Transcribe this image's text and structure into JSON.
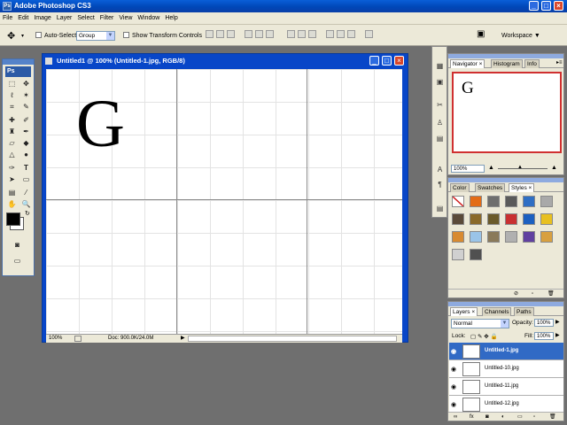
{
  "app": {
    "title": "Adobe Photoshop CS3"
  },
  "menu": [
    "File",
    "Edit",
    "Image",
    "Layer",
    "Select",
    "Filter",
    "View",
    "Window",
    "Help"
  ],
  "options": {
    "auto_select_label": "Auto-Select:",
    "auto_select_value": "Group",
    "show_transform_label": "Show Transform Controls",
    "workspace_label": "Workspace"
  },
  "toolbox": {
    "logo": "Ps"
  },
  "document": {
    "title": "Untitled1 @ 100% (Untitled-1.jpg, RGB/8)",
    "canvas_letter": "G",
    "zoom": "100%",
    "doc_info": "Doc: 900.0K/24.0M"
  },
  "navigator": {
    "tabs": [
      "Navigator",
      "Histogram",
      "Info"
    ],
    "preview_letter": "G",
    "zoom": "100%"
  },
  "styles_panel": {
    "tabs": [
      "Color",
      "Swatches",
      "Styles"
    ],
    "swatches": [
      "#ffffff",
      "#e36c16",
      "#6e6e6e",
      "#5a5a5a",
      "#2f6fc4",
      "#a9a9a9",
      "#5a4a3a",
      "#8a6a2a",
      "#6a5a2a",
      "#c83030",
      "#1c60c0",
      "#e8c020",
      "#d88a30",
      "#9ac4e8",
      "#8a7a5a",
      "#b0b0b0",
      "#6040a0",
      "#d8a040",
      "#d0d0d0",
      "#505050"
    ]
  },
  "layers": {
    "tabs": [
      "Layers",
      "Channels",
      "Paths"
    ],
    "blend_mode": "Normal",
    "opacity_label": "Opacity:",
    "opacity_value": "100%",
    "lock_label": "Lock:",
    "fill_label": "Fill:",
    "fill_value": "100%",
    "items": [
      {
        "name": "Untitled-1.jpg",
        "selected": true
      },
      {
        "name": "Untitled-10.jpg",
        "selected": false
      },
      {
        "name": "Untitled-11.jpg",
        "selected": false
      },
      {
        "name": "Untitled-12.jpg",
        "selected": false
      }
    ]
  }
}
